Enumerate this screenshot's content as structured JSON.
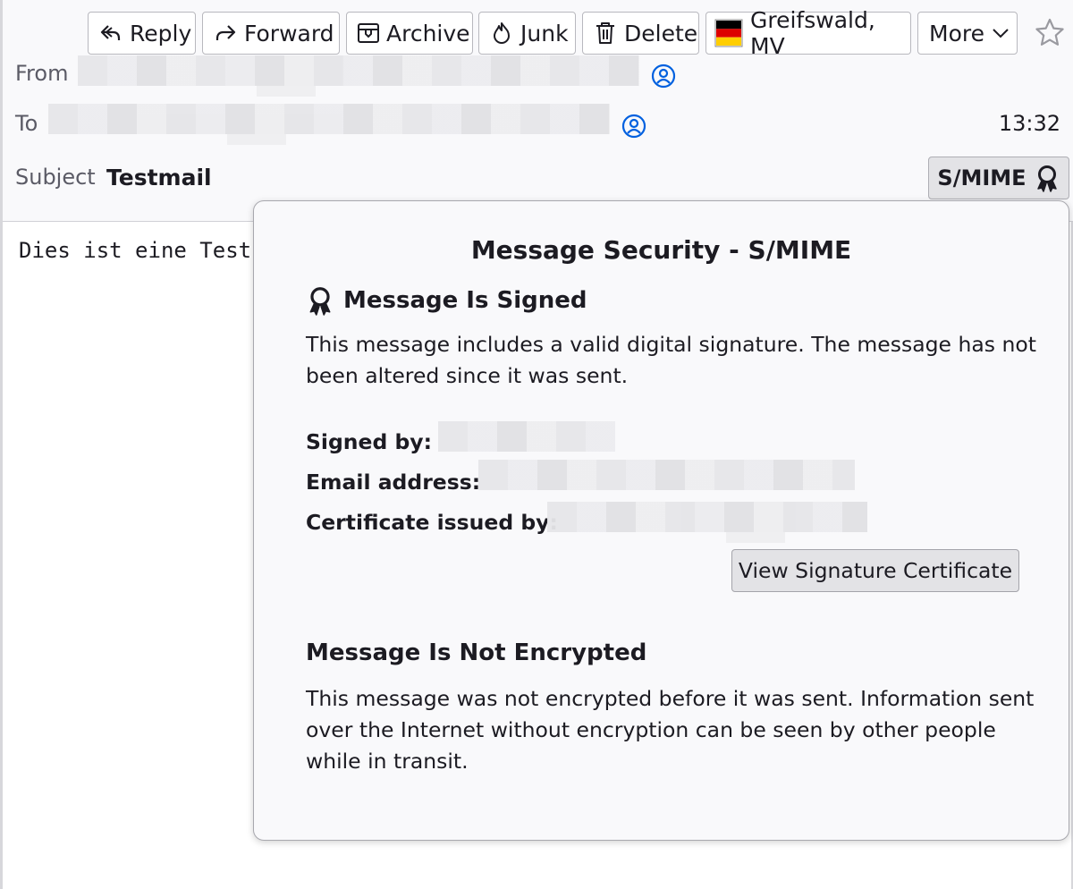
{
  "toolbar": {
    "reply": "Reply",
    "forward": "Forward",
    "archive": "Archive",
    "junk": "Junk",
    "delete": "Delete",
    "location": "Greifswald, MV",
    "more": "More",
    "icons": [
      "reply-icon",
      "forward-icon",
      "archive-icon",
      "junk-icon",
      "delete-icon",
      "german-flag-icon",
      "chevron-down-icon",
      "star-icon"
    ]
  },
  "header": {
    "from_label": "From",
    "to_label": "To",
    "subject_label": "Subject",
    "subject": "Testmail",
    "time": "13:32",
    "smime_label": "S/MIME"
  },
  "body": {
    "text": "Dies ist eine Test"
  },
  "popup": {
    "title": "Message Security - S/MIME",
    "signed_heading": "Message Is Signed",
    "signed_text": "This message includes a valid digital signature. The message has not been altered since it was sent.",
    "signed_by_label": "Signed by:",
    "email_label": "Email address:",
    "issuer_label": "Certificate issued by:",
    "view_cert_button": "View Signature Certificate",
    "encryption_heading": "Message Is Not Encrypted",
    "encryption_text": "This message was not encrypted before it was sent. Information sent over the Internet without encryption can be seen by other people while in transit."
  },
  "colors": {
    "header_bg": "#f9f9fb",
    "popup_bg": "#f9f9fb",
    "button_bg": "#e3e3e6",
    "contact_icon": "#0060df",
    "flag_black": "#000000",
    "flag_red": "#dd0000",
    "flag_gold": "#ffce00"
  }
}
